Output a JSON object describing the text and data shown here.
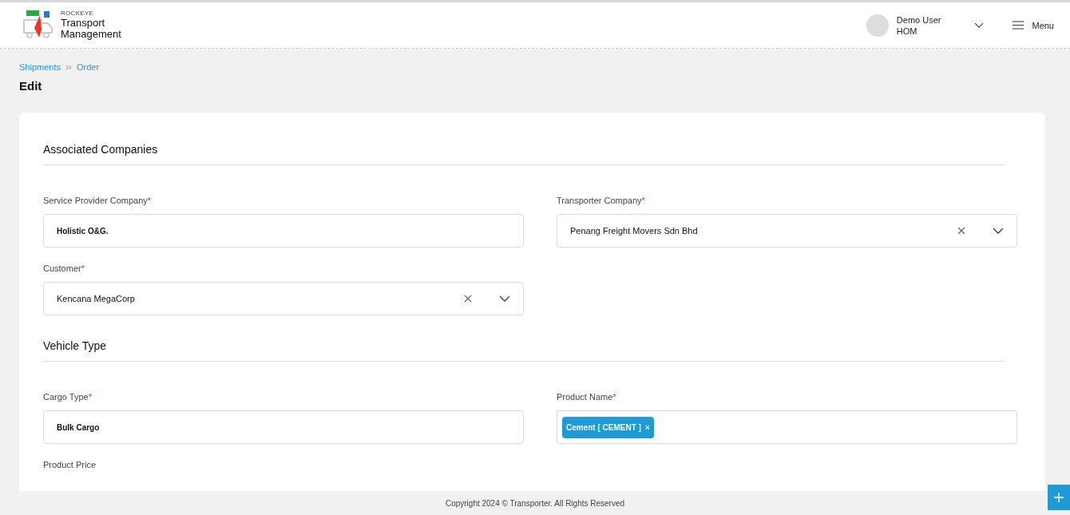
{
  "header": {
    "brand_small": "ROCKEYE",
    "brand_line1": "Transport",
    "brand_line2": "Management",
    "user_name": "Demo User",
    "user_role": "HOM",
    "menu_label": "Menu"
  },
  "breadcrumb": [
    {
      "label": "Shipments"
    },
    {
      "label": "Order"
    }
  ],
  "page_title": "Edit",
  "sections": [
    {
      "title": "Associated Companies",
      "fields": [
        {
          "label": "Service Provider Company",
          "required_mark": "*",
          "kind": "text",
          "value": "Holistic O&G."
        },
        {
          "label": "Transporter Company",
          "required_mark": "*",
          "kind": "select",
          "value": "Penang Freight Movers Sdn Bhd"
        },
        {
          "label": "Customer",
          "required_mark": "*",
          "kind": "select",
          "value": "Kencana MegaCorp"
        }
      ]
    },
    {
      "title": "Vehicle Type",
      "fields": [
        {
          "label": "Cargo Type",
          "required_mark": "*",
          "kind": "text",
          "value": "Bulk Cargo"
        },
        {
          "label": "Product Name",
          "required_mark": "*",
          "kind": "tags",
          "tags": [
            {
              "label": "Cement [ CEMENT ]",
              "remove": "×"
            }
          ]
        },
        {
          "label": "Product Price",
          "kind": "label"
        }
      ]
    }
  ],
  "footer": "Copyright 2024 © Transporter. All Rights Reserved"
}
